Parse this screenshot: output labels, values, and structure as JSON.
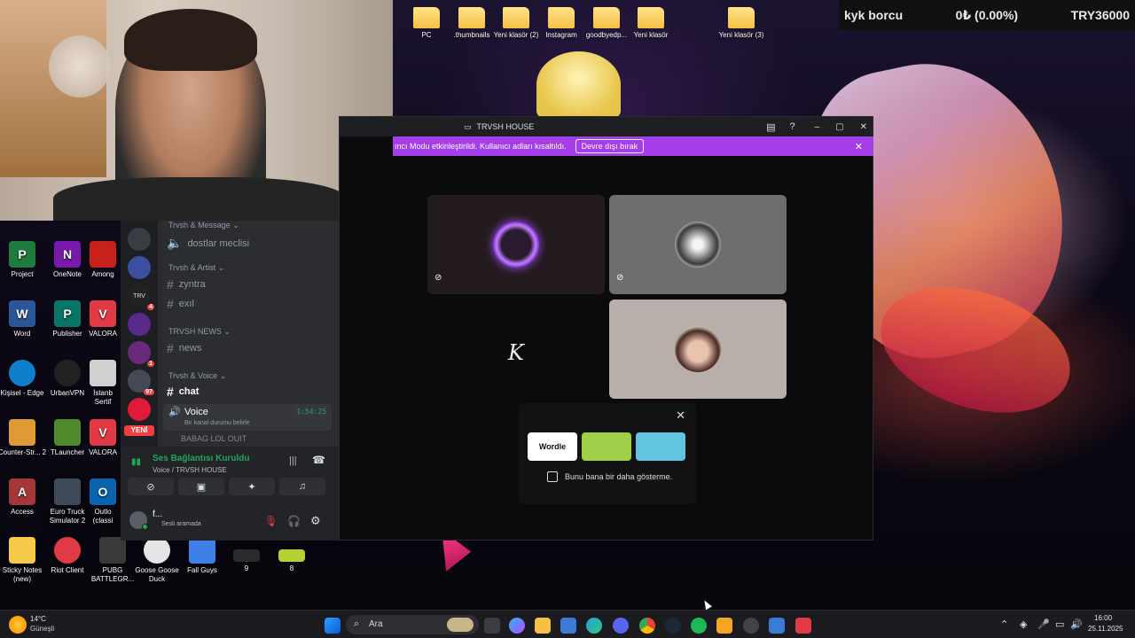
{
  "top_folders": [
    {
      "label": "PC"
    },
    {
      "label": ".thumbnails"
    },
    {
      "label": "Yeni klasör (2)"
    },
    {
      "label": "Instagram"
    },
    {
      "label": "goodbyedp..."
    },
    {
      "label": "Yeni klasör"
    },
    {
      "label": "Yeni klasör (3)"
    }
  ],
  "ticker": {
    "left": "kyk borcu",
    "middle": "0₺ (0.00%)",
    "right": "TRY36000"
  },
  "desktop_icons": [
    {
      "label": "Project",
      "color": "#1f7a3d"
    },
    {
      "label": "OneNote",
      "color": "#7719aa"
    },
    {
      "label": "Among",
      "color": "#c8201b"
    },
    {
      "label": "Word",
      "color": "#2b579a"
    },
    {
      "label": "Publisher",
      "color": "#077568"
    },
    {
      "label": "VALORA",
      "color": "#e13a46"
    },
    {
      "label": "Kişisel - Edge",
      "color": "#0f7fcc"
    },
    {
      "label": "UrbanVPN",
      "color": "#222222"
    },
    {
      "label": "İstanb Sertif",
      "color": "#d0d0d0"
    },
    {
      "label": "Counter-Str... 2",
      "color": "#de9b35"
    },
    {
      "label": "TLauncher",
      "color": "#4f8b2d"
    },
    {
      "label": "VALORA",
      "color": "#e13a46"
    },
    {
      "label": "Access",
      "color": "#a4373a"
    },
    {
      "label": "Euro Truck Simulator 2",
      "color": "#3d4a5a"
    },
    {
      "label": "Outlo (classi",
      "color": "#0a64ad"
    },
    {
      "label": "Sticky Notes (new)",
      "color": "#f7c948"
    },
    {
      "label": "Riot Client",
      "color": "#e13a46"
    },
    {
      "label": "PUBG BATTLEGR...",
      "color": "#3a3a3a"
    },
    {
      "label": "Goose Goose Duck",
      "color": "#e6e6e6"
    },
    {
      "label": "Fall Guys",
      "color": "#3f7fe8"
    },
    {
      "label": "9",
      "color": "#2b2b2b"
    },
    {
      "label": "8",
      "color": "#b3d334"
    }
  ],
  "discord": {
    "window_title": "TRVSH HOUSE",
    "banner_text": "ıncı Modu etkinleştirildi. Kullanıcı adları kısaltıldı.",
    "banner_button": "Devre dışı bırak",
    "categories": [
      {
        "name": "Trvsh & Message",
        "channels": [
          {
            "name": "dostlar meclisi",
            "type": "voice"
          }
        ]
      },
      {
        "name": "Trvsh & Artist",
        "channels": [
          {
            "name": "zyntra",
            "type": "text"
          },
          {
            "name": "exıl",
            "type": "text"
          }
        ]
      },
      {
        "name": "TRVSH NEWS",
        "channels": [
          {
            "name": "news",
            "type": "text"
          }
        ]
      },
      {
        "name": "Trvsh & Voice",
        "channels": [
          {
            "name": "chat",
            "type": "text"
          },
          {
            "name": "Voice",
            "type": "voice"
          }
        ]
      }
    ],
    "voice_timer": "1:54:25",
    "voice_status_hint": "Bir kanal durumu belirle",
    "voice_member": "BABAG LOL QUIT",
    "server_badges": [
      "YENİ",
      "1",
      "97",
      "4"
    ],
    "connection_status": "Ses Bağlantısı Kuruldu",
    "connection_detail": "Voice / TRVSH HOUSE",
    "user_name": "f...",
    "user_status": "Sesli aramada",
    "participant_initial": "K",
    "popup_checkbox_label": "Bunu bana bir daha gösterme.",
    "games": [
      {
        "name": "Wordle",
        "color": "#ffffff",
        "text_color": "#111"
      },
      {
        "name": "",
        "color": "#9fd04a",
        "text_color": "#111"
      },
      {
        "name": "",
        "color": "#62c5e0",
        "text_color": "#111"
      }
    ],
    "accent_color": "#a33ee8",
    "status_green": "#23a55a"
  },
  "taskbar": {
    "weather_temp": "14°C",
    "weather_desc": "Güneşli",
    "search_placeholder": "Ara",
    "time": "16:00",
    "date": "25.11.2025"
  }
}
